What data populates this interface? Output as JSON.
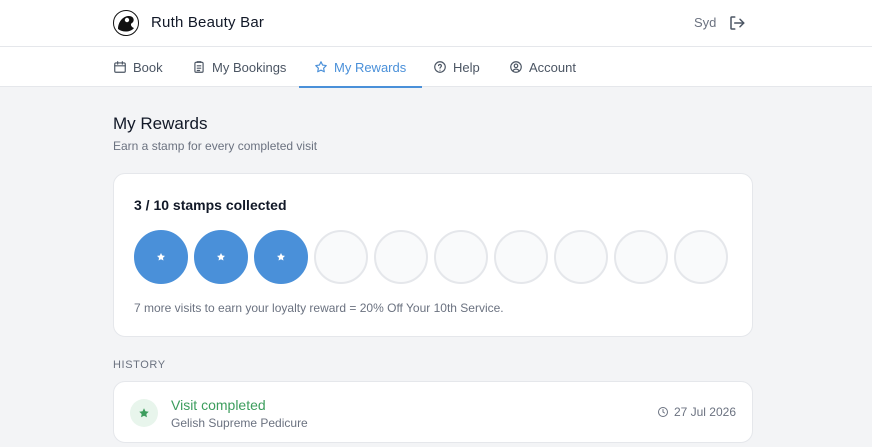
{
  "header": {
    "brand": "Ruth Beauty Bar",
    "logo_icon": "salon-logo-icon",
    "user_name": "Syd",
    "logout_icon": "logout-icon"
  },
  "nav": {
    "tabs": [
      {
        "label": "Book",
        "icon": "calendar-icon",
        "active": false
      },
      {
        "label": "My Bookings",
        "icon": "clipboard-icon",
        "active": false
      },
      {
        "label": "My Rewards",
        "icon": "star-icon",
        "active": true
      },
      {
        "label": "Help",
        "icon": "help-circle-icon",
        "active": false
      },
      {
        "label": "Account",
        "icon": "user-circle-icon",
        "active": false
      }
    ],
    "accent_color": "#4a90d9"
  },
  "page": {
    "title": "My Rewards",
    "subtitle": "Earn a stamp for every completed visit"
  },
  "stamp_card": {
    "title": "3 / 10 stamps collected",
    "collected": 3,
    "total": 10,
    "note": "7 more visits to earn your loyalty reward = 20% Off Your 10th Service."
  },
  "history": {
    "label": "HISTORY",
    "items": [
      {
        "title": "Visit completed",
        "service": "Gelish Supreme Pedicure",
        "date": "27 Jul 2026",
        "status_color": "#3c9d5d"
      }
    ]
  }
}
